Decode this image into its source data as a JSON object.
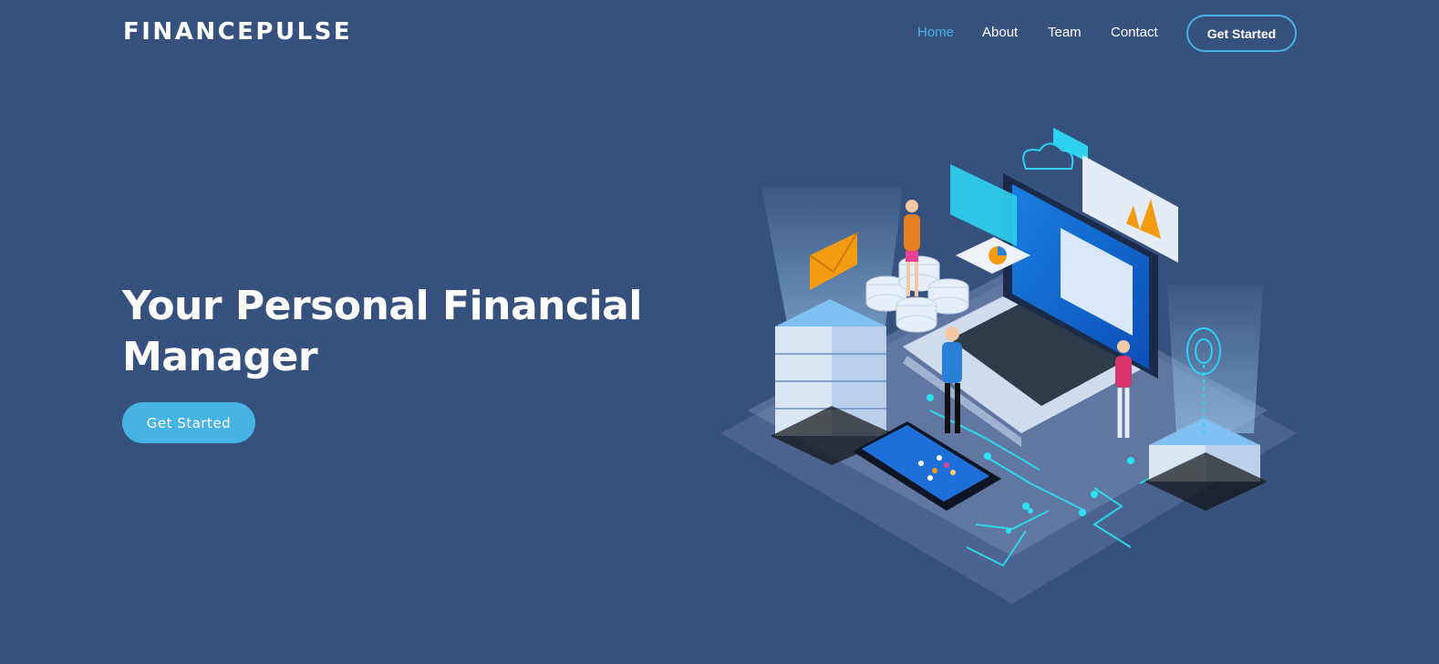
{
  "brand": {
    "logo_text": "FINANCEPULSE"
  },
  "nav": {
    "items": [
      {
        "label": "Home",
        "active": true
      },
      {
        "label": "About",
        "active": false
      },
      {
        "label": "Team",
        "active": false
      },
      {
        "label": "Contact",
        "active": false
      }
    ],
    "cta_label": "Get Started"
  },
  "hero": {
    "title_line1": "Your Personal Financial",
    "title_line2": "Manager",
    "cta_label": "Get Started"
  },
  "colors": {
    "background": "#37517e",
    "accent": "#47b2e4",
    "text": "#ffffff"
  },
  "illustration": {
    "icon": "isometric-finance-technology-illustration"
  }
}
